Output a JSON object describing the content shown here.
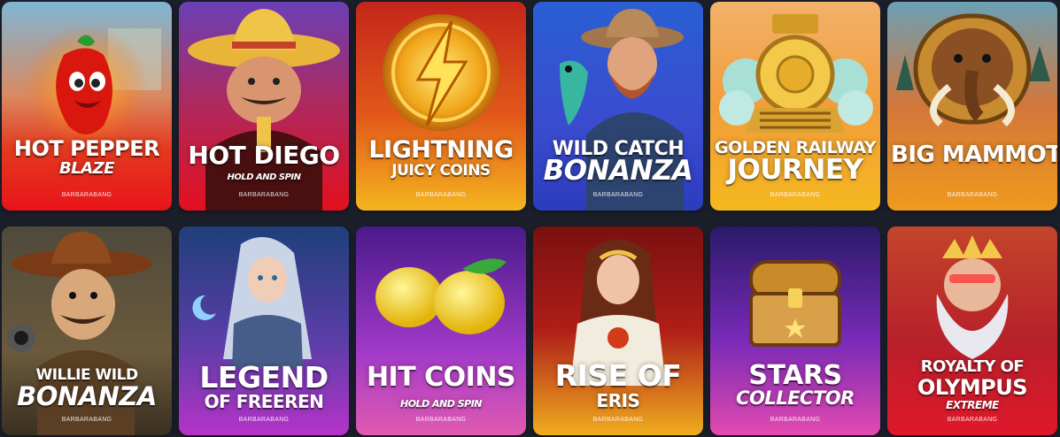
{
  "provider": "BARBARABANG",
  "games": [
    {
      "line1": "HOT PEPPER",
      "line2": "BLAZE"
    },
    {
      "line1": "HOT DIEGO",
      "line2": "HOLD AND SPIN"
    },
    {
      "line1": "LIGHTNING",
      "line2": "JUICY COINS"
    },
    {
      "line1": "WILD CATCH",
      "line2": "BONANZA"
    },
    {
      "line1": "GOLDEN RAILWAY",
      "line2": "JOURNEY"
    },
    {
      "line1": "BIG MAMMOTH",
      "line2": ""
    },
    {
      "line1": "WILLIE WILD",
      "line2": "BONANZA"
    },
    {
      "line1": "LEGEND",
      "line2": "OF FREEREN"
    },
    {
      "line1": "HIT COINS",
      "line2": "HOLD AND SPIN"
    },
    {
      "line1": "RISE OF",
      "line2": "ERIS"
    },
    {
      "line1": "STARS",
      "line2": "COLLECTOR"
    },
    {
      "line1": "ROYALTY OF",
      "line2": "OLYMPUS",
      "line3": "EXTREME"
    }
  ]
}
